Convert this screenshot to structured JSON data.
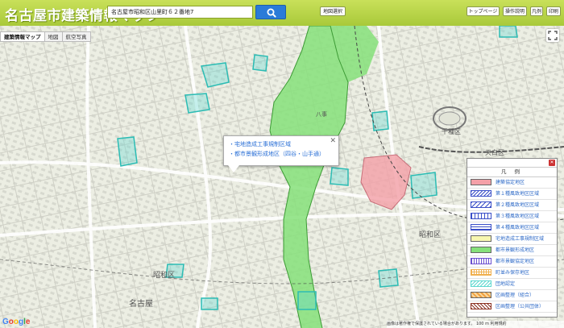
{
  "header": {
    "title": "名古屋市建築情報マップ",
    "search_value": "名古屋市昭和区山里町６２番地7",
    "map_select": "地図選択",
    "top_page": "トップページ",
    "manual": "操作説明",
    "legend": "凡例",
    "print": "印刷"
  },
  "tabs": [
    {
      "label": "建築情報マップ",
      "active": true
    },
    {
      "label": "地図",
      "active": false
    },
    {
      "label": "航空写真",
      "active": false
    }
  ],
  "map": {
    "place_labels": {
      "showa_ku": "昭和区",
      "shiratori": "天白区",
      "nagoya_univ": "名古屋",
      "yagoto": "八事",
      "chikusa": "千種区",
      "showa2": "昭和区"
    }
  },
  "popup": {
    "lines": [
      "・宅地造成工事規制区域",
      "・都市景観形成地区（四谷・山手通）"
    ]
  },
  "legend": {
    "title": "凡 例",
    "items": [
      {
        "label": "建築協定地区",
        "color": "#f4a0a8",
        "pattern": "solid"
      },
      {
        "label": "第１種風致地区区域",
        "color": "#3a4fc8",
        "pattern": "hatch"
      },
      {
        "label": "第２種風致地区区域",
        "color": "#3a4fc8",
        "pattern": "hatch2"
      },
      {
        "label": "第３種風致地区区域",
        "color": "#3a4fc8",
        "pattern": "hatch3"
      },
      {
        "label": "第４種風致地区区域",
        "color": "#3a4fc8",
        "pattern": "hatch4"
      },
      {
        "label": "宅地造成工事規制区域",
        "color": "#f7f7b0",
        "pattern": "solid"
      },
      {
        "label": "都市景観形成地区",
        "color": "#86e07a",
        "pattern": "solid"
      },
      {
        "label": "都市景観協定地区",
        "color": "#6b4fd0",
        "pattern": "vert"
      },
      {
        "label": "町並み保存地区",
        "color": "#f0b050",
        "pattern": "grid"
      },
      {
        "label": "団地認定",
        "color": "#5fd8d0",
        "pattern": "hatch"
      },
      {
        "label": "区画整理（組合）",
        "color": "#f0a040",
        "pattern": "solid2"
      },
      {
        "label": "区画整理（公共団体）",
        "color": "#8a3020",
        "pattern": "hatch5"
      }
    ]
  },
  "footer": {
    "google": "Google",
    "copyright": "画像は著作権で保護されている場合があります。  100 m    利用規約"
  },
  "colors": {
    "header_green": "#a9c93a",
    "landscape_green": "#86e07a",
    "agreement_pink": "#f4a0a8",
    "danchi_cyan": "#5fd8d0",
    "link_blue": "#2f6bc8"
  }
}
